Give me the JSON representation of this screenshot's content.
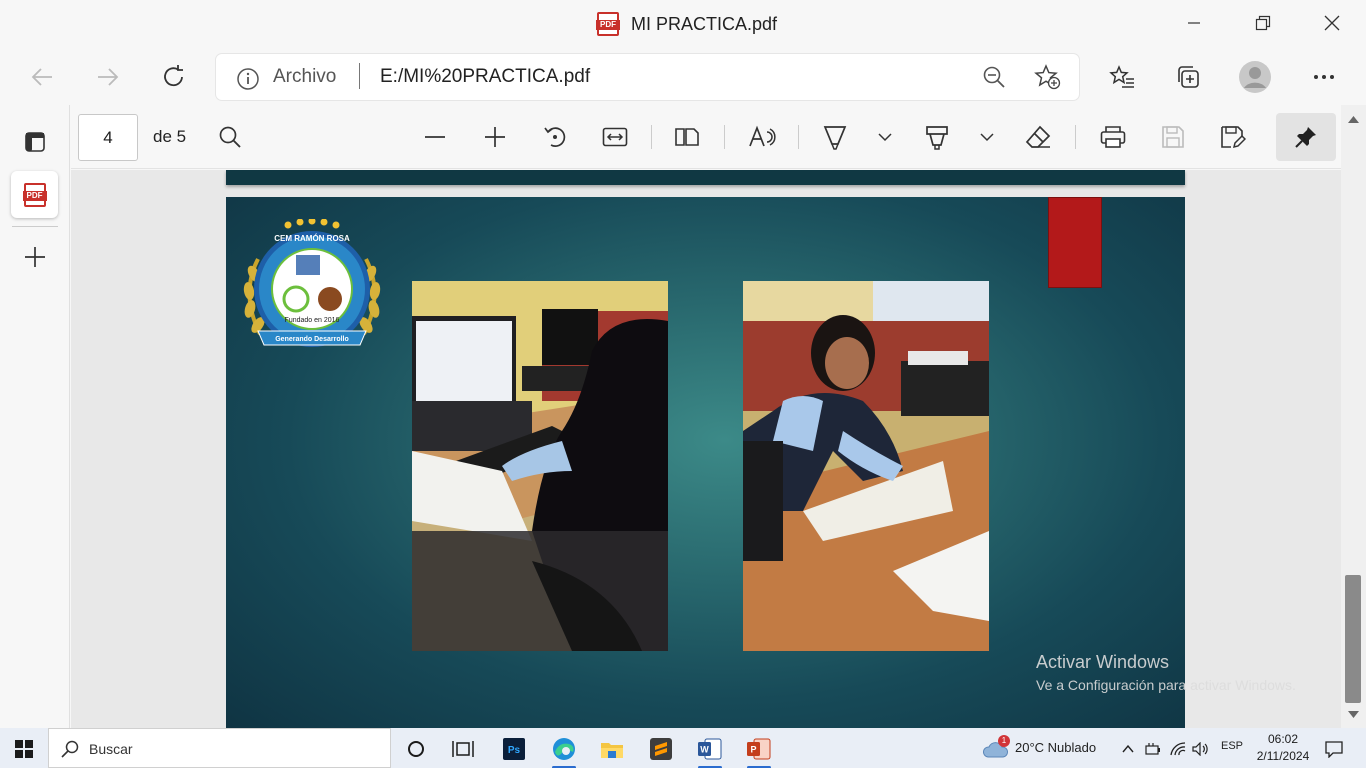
{
  "window": {
    "title": "MI PRACTICA.pdf"
  },
  "address_bar": {
    "scheme_label": "Archivo",
    "url": "E:/MI%20PRACTICA.pdf"
  },
  "pdf_toolbar": {
    "page_current": "4",
    "page_total_label": "de 5"
  },
  "slide": {
    "logo": {
      "top_text": "CEM RAMÓN ROSA",
      "middle_text": "Fundado en 2016",
      "bottom_ring": "SANTA ROSITA, GUAJIQUIRO, LA PAZ",
      "ribbon": "Generando Desarrollo"
    },
    "photos": [
      "student-at-computer",
      "student-writing-at-desk"
    ]
  },
  "watermark": {
    "line1": "Activar Windows",
    "line2": "Ve a Configuración para activar Windows."
  },
  "taskbar": {
    "search_placeholder": "Buscar",
    "weather": "20°C  Nublado",
    "weather_badge": "1",
    "language": "ESP",
    "time": "06:02",
    "date": "2/11/2024"
  },
  "colors": {
    "slide_dark": "#0f3342",
    "slide_light": "#3c8a88",
    "red_accent": "#b3191a",
    "pdf_red": "#c8312b"
  }
}
